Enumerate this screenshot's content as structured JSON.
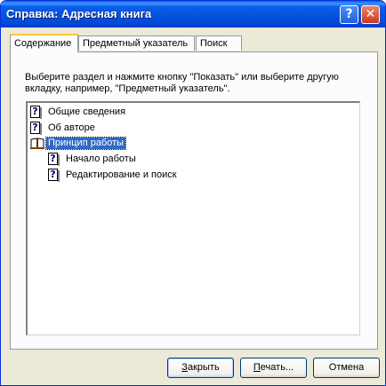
{
  "window": {
    "title": "Справка: Адресная книга",
    "help_glyph": "?",
    "close_glyph": "✕"
  },
  "tabs": [
    {
      "label": "Содержание",
      "active": true
    },
    {
      "label": "Предметный указатель",
      "active": false
    },
    {
      "label": "Поиск",
      "active": false
    }
  ],
  "instructions": "Выберите раздел и нажмите кнопку \"Показать\" или выберите другую вкладку, например, \"Предметный указатель\".",
  "tree": {
    "items": [
      {
        "label": "Общие сведения",
        "icon": "help-topic-icon",
        "level": 0
      },
      {
        "label": "Об авторе",
        "icon": "help-topic-icon",
        "level": 0
      },
      {
        "label": "Принцип работы",
        "icon": "open-book-icon",
        "level": 0,
        "selected": true
      },
      {
        "label": "Начало работы",
        "icon": "help-topic-icon",
        "level": 1
      },
      {
        "label": "Редактирование и поиск",
        "icon": "help-topic-icon",
        "level": 1
      }
    ]
  },
  "buttons": {
    "close": {
      "accel": "З",
      "rest": "акрыть"
    },
    "print": {
      "accel": "П",
      "rest": "ечать..."
    },
    "cancel": "Отмена"
  },
  "colors": {
    "title_bar": "#0553df",
    "selection": "#316ac5",
    "active_tab_highlight": "#ffc83c"
  }
}
